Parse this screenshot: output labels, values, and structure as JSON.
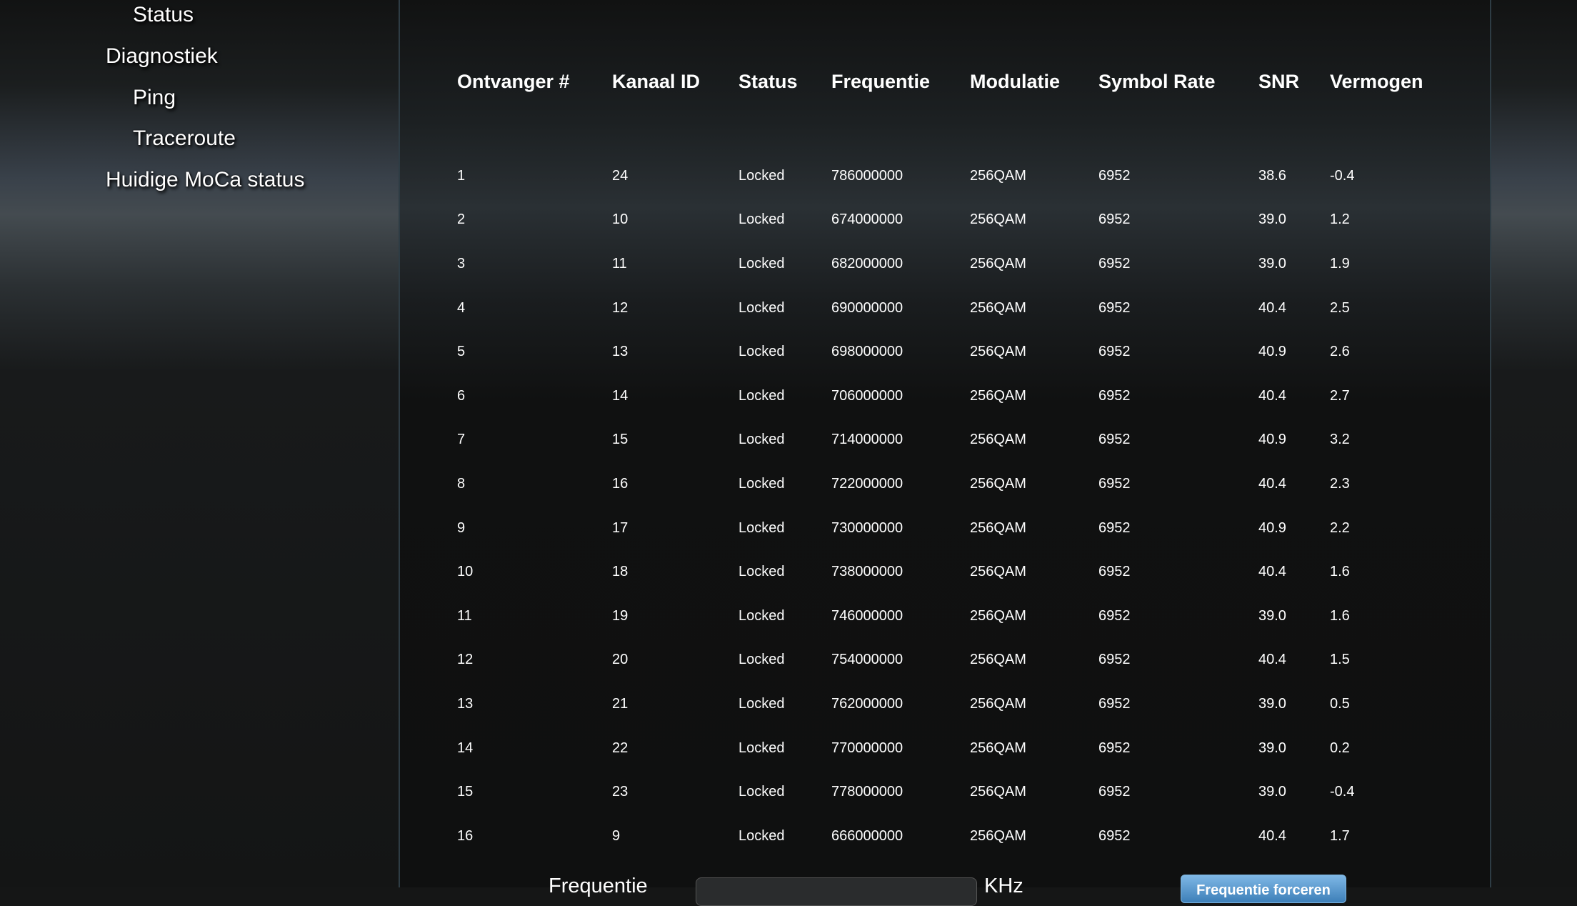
{
  "sidebar": {
    "items": [
      {
        "label": "Status"
      },
      {
        "label": "Diagnostiek"
      },
      {
        "label": "Ping"
      },
      {
        "label": "Traceroute"
      },
      {
        "label": "Huidige MoCa status"
      }
    ]
  },
  "table": {
    "headers": [
      "Ontvanger #",
      "Kanaal ID",
      "Status",
      "Frequentie",
      "Modulatie",
      "Symbol Rate",
      "SNR",
      "Vermogen"
    ],
    "rows": [
      [
        "1",
        "24",
        "Locked",
        "786000000",
        "256QAM",
        "6952",
        "38.6",
        "-0.4"
      ],
      [
        "2",
        "10",
        "Locked",
        "674000000",
        "256QAM",
        "6952",
        "39.0",
        "1.2"
      ],
      [
        "3",
        "11",
        "Locked",
        "682000000",
        "256QAM",
        "6952",
        "39.0",
        "1.9"
      ],
      [
        "4",
        "12",
        "Locked",
        "690000000",
        "256QAM",
        "6952",
        "40.4",
        "2.5"
      ],
      [
        "5",
        "13",
        "Locked",
        "698000000",
        "256QAM",
        "6952",
        "40.9",
        "2.6"
      ],
      [
        "6",
        "14",
        "Locked",
        "706000000",
        "256QAM",
        "6952",
        "40.4",
        "2.7"
      ],
      [
        "7",
        "15",
        "Locked",
        "714000000",
        "256QAM",
        "6952",
        "40.9",
        "3.2"
      ],
      [
        "8",
        "16",
        "Locked",
        "722000000",
        "256QAM",
        "6952",
        "40.4",
        "2.3"
      ],
      [
        "9",
        "17",
        "Locked",
        "730000000",
        "256QAM",
        "6952",
        "40.9",
        "2.2"
      ],
      [
        "10",
        "18",
        "Locked",
        "738000000",
        "256QAM",
        "6952",
        "40.4",
        "1.6"
      ],
      [
        "11",
        "19",
        "Locked",
        "746000000",
        "256QAM",
        "6952",
        "39.0",
        "1.6"
      ],
      [
        "12",
        "20",
        "Locked",
        "754000000",
        "256QAM",
        "6952",
        "40.4",
        "1.5"
      ],
      [
        "13",
        "21",
        "Locked",
        "762000000",
        "256QAM",
        "6952",
        "39.0",
        "0.5"
      ],
      [
        "14",
        "22",
        "Locked",
        "770000000",
        "256QAM",
        "6952",
        "39.0",
        "0.2"
      ],
      [
        "15",
        "23",
        "Locked",
        "778000000",
        "256QAM",
        "6952",
        "39.0",
        "-0.4"
      ],
      [
        "16",
        "9",
        "Locked",
        "666000000",
        "256QAM",
        "6952",
        "40.4",
        "1.7"
      ]
    ]
  },
  "force_frequency": {
    "label": "Frequentie",
    "input_value": "",
    "unit": "KHz",
    "button_label": "Frequentie forceren"
  },
  "colors": {
    "background": "#151616",
    "text": "#ffffff",
    "button_blue": "#3d7fb8",
    "panel_border": "#2e3c44"
  }
}
